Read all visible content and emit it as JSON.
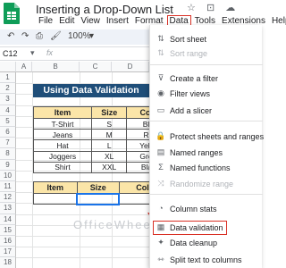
{
  "doc": {
    "title": "Inserting a Drop-Down List",
    "title_icons": [
      "☆",
      "⊡",
      "☁"
    ]
  },
  "menu": [
    "File",
    "Edit",
    "View",
    "Insert",
    "Format",
    "Data",
    "Tools",
    "Extensions",
    "Help"
  ],
  "menu_active": "Data",
  "toolbar": {
    "undo": "↶",
    "redo": "↷",
    "print": "⎙",
    "paint": "🖌",
    "zoom": "100%",
    "zoom_caret": "▾"
  },
  "formula_bar": {
    "cell_ref": "C12",
    "caret": "▾",
    "fx": "fx"
  },
  "sheet": {
    "columns": [
      "A",
      "B",
      "C",
      "D"
    ],
    "rows": [
      "1",
      "2",
      "3",
      "4",
      "5",
      "6",
      "7",
      "8",
      "9",
      "10",
      "11",
      "12",
      "13",
      "14",
      "15",
      "16",
      "17",
      "18"
    ],
    "banner": "Using Data Validation",
    "table": {
      "headers": [
        "Item",
        "Size",
        "Color"
      ],
      "rows": [
        [
          "T-Shirt",
          "S",
          "Blue"
        ],
        [
          "Jeans",
          "M",
          "Red"
        ],
        [
          "Hat",
          "L",
          "Yellow"
        ],
        [
          "Joggers",
          "XL",
          "Green"
        ],
        [
          "Shirt",
          "XXL",
          "Black"
        ]
      ]
    },
    "output_table": {
      "headers": [
        "Item",
        "Size",
        "Color"
      ],
      "row": [
        "",
        "",
        ""
      ]
    }
  },
  "watermark": "OfficeWheel",
  "dropdown": {
    "items": [
      {
        "icon": "⇅",
        "label": "Sort sheet",
        "enabled": true
      },
      {
        "icon": "⇅",
        "label": "Sort range",
        "enabled": false
      },
      {
        "icon": "⊽",
        "label": "Create a filter",
        "enabled": true
      },
      {
        "icon": "◉",
        "label": "Filter views",
        "enabled": true
      },
      {
        "icon": "▭",
        "label": "Add a slicer",
        "enabled": true
      },
      {
        "icon": "🔒",
        "label": "Protect sheets and ranges",
        "enabled": true
      },
      {
        "icon": "▤",
        "label": "Named ranges",
        "enabled": true
      },
      {
        "icon": "Σ",
        "label": "Named functions",
        "enabled": true
      },
      {
        "icon": "⤨",
        "label": "Randomize range",
        "enabled": false
      },
      {
        "icon": "◔",
        "label": "Column stats",
        "enabled": true
      },
      {
        "icon": "▦",
        "label": "Data validation",
        "enabled": true,
        "highlighted": true
      },
      {
        "icon": "✦",
        "label": "Data cleanup",
        "enabled": true
      },
      {
        "icon": "⇿",
        "label": "Split text to columns",
        "enabled": true
      }
    ]
  },
  "colors": {
    "banner_bg": "#1f4e79",
    "header_bg": "#fbe5a8",
    "accent_red": "#d93025",
    "selection_blue": "#1a73e8"
  }
}
